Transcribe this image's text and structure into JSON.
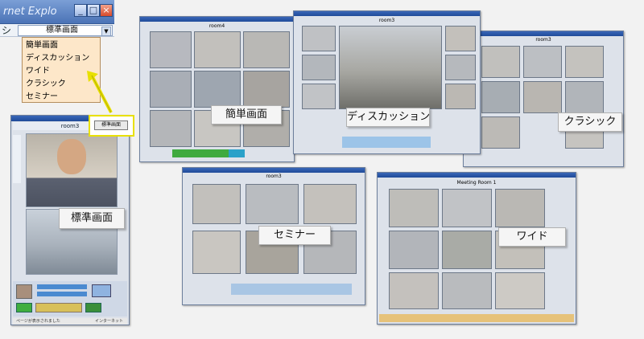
{
  "ie_window": {
    "title": "rnet Explo",
    "buttons": [
      "_",
      "□",
      "×"
    ]
  },
  "mode_selector": {
    "selected": "標準画面",
    "options": [
      "簡単画面",
      "ディスカッション",
      "ワイド",
      "クラシック",
      "セミナー"
    ]
  },
  "small_window": {
    "room_title": "room3",
    "mode_button": "標準画面",
    "status_left": "ページが表示されました",
    "status_right": "インターネット"
  },
  "captions": {
    "standard": "標準画面",
    "simple": "簡単画面",
    "discussion": "ディスカッション",
    "classic": "クラシック",
    "seminar": "セミナー",
    "wide": "ワイド"
  },
  "windows": {
    "simple_room": "room4",
    "discussion_room": "room3",
    "classic_room": "room3",
    "seminar_room": "room3",
    "wide_room": "Meeting Room 1"
  },
  "colors": {
    "menu_bg": "#fde7c9",
    "highlight": "#e8e000",
    "titlebar": "#2a56a8"
  }
}
